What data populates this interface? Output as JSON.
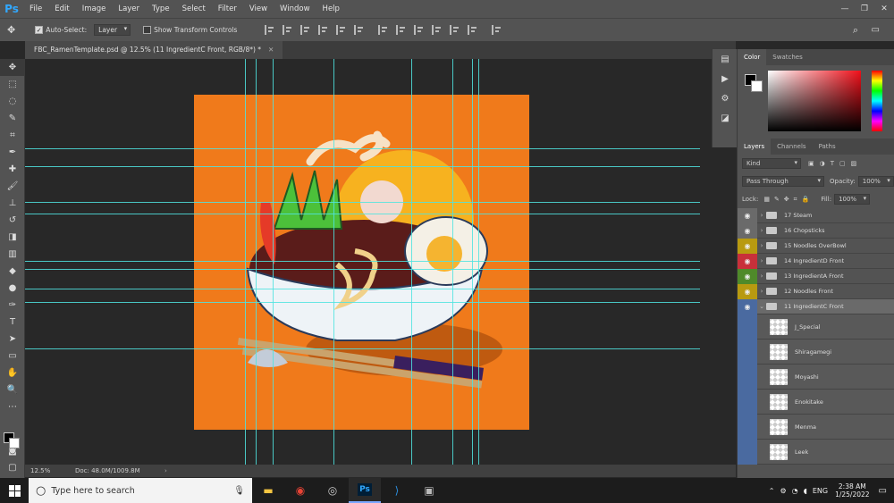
{
  "app": {
    "logo": "Ps"
  },
  "menu": [
    "File",
    "Edit",
    "Image",
    "Layer",
    "Type",
    "Select",
    "Filter",
    "View",
    "Window",
    "Help"
  ],
  "options": {
    "auto_select_label": "Auto-Select:",
    "auto_select_value": "Layer",
    "transform_label": "Show Transform Controls"
  },
  "document": {
    "tab_title": "FBC_RamenTemplate.psd @ 12.5% (11 IngredientC Front, RGB/8*) *",
    "zoom": "12.5%",
    "doc_size": "Doc: 48.0M/1009.8M"
  },
  "colors": {
    "artboard": "#f07a1b",
    "guide": "#4fe3e1",
    "accent": "#31a8ff"
  },
  "panels": {
    "color_tabs": [
      "Color",
      "Swatches"
    ],
    "layer_tabs": [
      "Layers",
      "Channels",
      "Paths"
    ],
    "filter_kind": "Kind",
    "blend_mode": "Pass Through",
    "opacity_label": "Opacity:",
    "opacity_value": "100%",
    "lock_label": "Lock:",
    "fill_label": "Fill:",
    "fill_value": "100%"
  },
  "layers": [
    {
      "name": "17 Steam",
      "color": "#6a6a6a"
    },
    {
      "name": "16 Chopsticks",
      "color": "#6a6a6a"
    },
    {
      "name": "15 Noodles OverBowl",
      "color": "#b89a10"
    },
    {
      "name": "14 IngredientD Front",
      "color": "#c8303a"
    },
    {
      "name": "13 IngredientA Front",
      "color": "#4f8a2a"
    },
    {
      "name": "12 Noodles Front",
      "color": "#b89a10"
    },
    {
      "name": "11 IngredientC Front",
      "color": "#4a6aa0"
    }
  ],
  "sublayers": [
    "J_Special",
    "Shiragamegi",
    "Moyashi",
    "Enokitake",
    "Menma",
    "Leek"
  ],
  "taskbar": {
    "search_placeholder": "Type here to search",
    "lang": "ENG",
    "time": "2:38 AM",
    "date": "1/25/2022"
  }
}
